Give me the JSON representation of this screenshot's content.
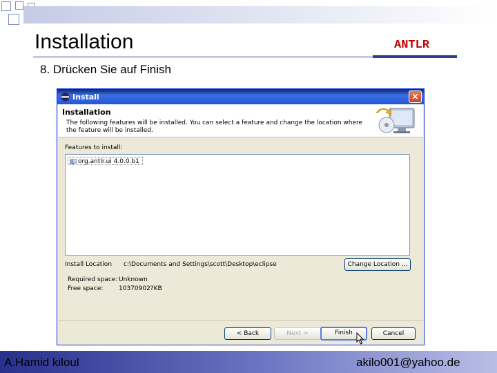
{
  "slide": {
    "title": "Installation",
    "tag": "ANTLR",
    "step": "8.  Drücken Sie auf Finish"
  },
  "dialog": {
    "window_title": "Install",
    "close_glyph": "✕",
    "header_title": "Installation",
    "header_description": "The following features will be installed. You can select a feature and change the location where the feature will be installed.",
    "features_label": "Features to install:",
    "features": [
      "org.antlr.ui 4.0.0.b1"
    ],
    "install_location_label": "Install Location",
    "install_location_value": "c:\\Documents and Settings\\scott\\Desktop\\eclipse",
    "change_location_button": "Change Location ...",
    "required_space_label": "Required space:",
    "required_space_value": "Unknown",
    "free_space_label": "Free space:",
    "free_space_value": "10370902?KB",
    "buttons": {
      "back": "< Back",
      "next": "Next >",
      "finish": "Finish",
      "cancel": "Cancel"
    },
    "icons": {
      "window": "eclipse-icon",
      "header": "install-monitor-icon",
      "feature": "feature-plugin-icon",
      "cursor": "mouse-pointer-icon"
    }
  },
  "footer": {
    "left": "A.Hamid kiloul",
    "right": "akilo001@yahoo.de"
  },
  "colors": {
    "accent": "#2e3a8c",
    "tag": "#c00000",
    "titlebar": "#2457d6",
    "dialog_bg": "#ece9d8"
  }
}
